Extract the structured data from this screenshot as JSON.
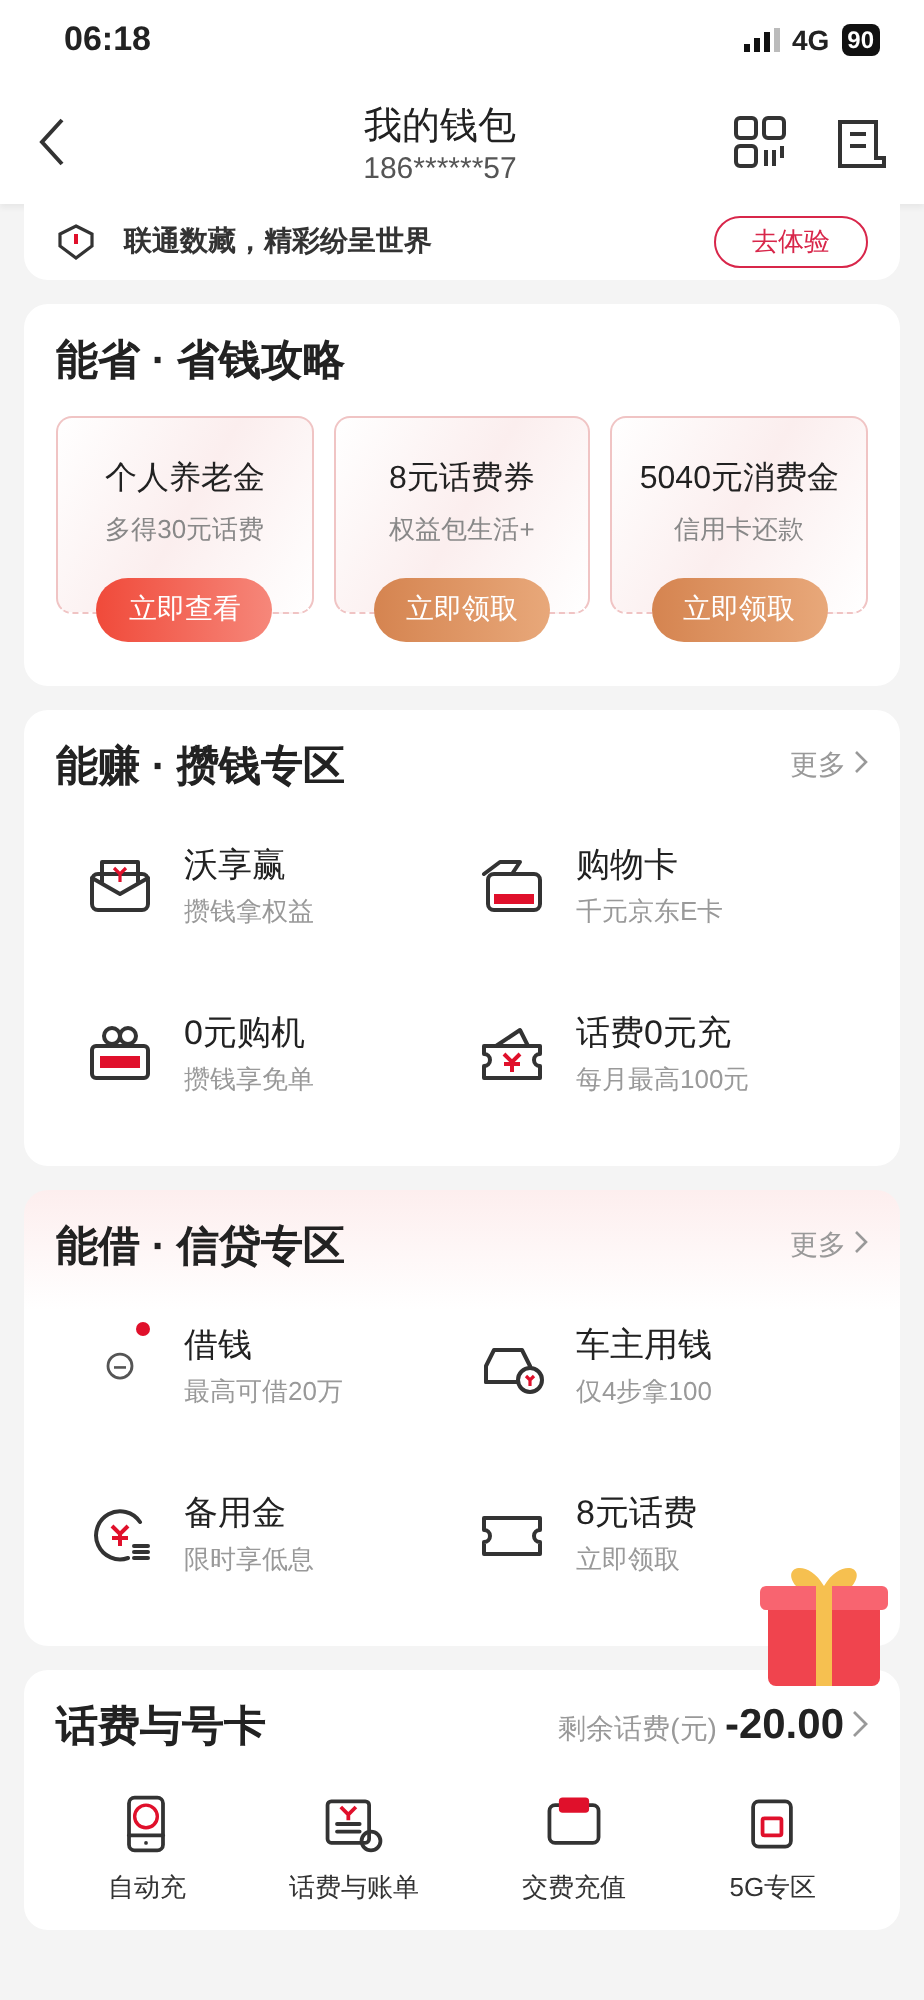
{
  "status_bar": {
    "time": "06:18",
    "network": "4G",
    "battery": "90"
  },
  "header": {
    "title": "我的钱包",
    "subtitle": "186******57"
  },
  "banner": {
    "text": "联通数藏，精彩纷呈世界",
    "button": "去体验"
  },
  "sections": [
    {
      "kind": "coupons",
      "title": "能省 · 省钱攻略",
      "coupons": [
        {
          "title": "个人养老金",
          "subtitle": "多得30元话费",
          "button": "立即查看",
          "highlight": true
        },
        {
          "title": "8元话费券",
          "subtitle": "权益包生活+",
          "button": "立即领取",
          "highlight": false
        },
        {
          "title": "5040元消费金",
          "subtitle": "信用卡还款",
          "button": "立即领取",
          "highlight": false
        }
      ]
    },
    {
      "kind": "grid",
      "title": "能赚 · 攒钱专区",
      "more": "更多",
      "tinted": false,
      "items": [
        {
          "title": "沃享赢",
          "subtitle": "攒钱拿权益",
          "dot": false
        },
        {
          "title": "购物卡",
          "subtitle": "千元京东E卡",
          "dot": false
        },
        {
          "title": "0元购机",
          "subtitle": "攒钱享免单",
          "dot": false
        },
        {
          "title": "话费0元充",
          "subtitle": "每月最高100元",
          "dot": false
        }
      ]
    },
    {
      "kind": "grid",
      "title": "能借 · 信贷专区",
      "more": "更多",
      "tinted": true,
      "items": [
        {
          "title": "借钱",
          "subtitle": "最高可借20万",
          "dot": true
        },
        {
          "title": "车主用钱",
          "subtitle": "仅4步拿100",
          "dot": false
        },
        {
          "title": "备用金",
          "subtitle": "限时享低息",
          "dot": false
        },
        {
          "title": "8元话费",
          "subtitle": "立即领取",
          "dot": false
        }
      ]
    },
    {
      "kind": "services",
      "title": "话费与号卡",
      "balance_label": "剩余话费(元)",
      "balance": "-20.00",
      "items": [
        {
          "label": "自动充"
        },
        {
          "label": "话费与账单"
        },
        {
          "label": "交费充值"
        },
        {
          "label": "5G专区"
        }
      ]
    }
  ]
}
